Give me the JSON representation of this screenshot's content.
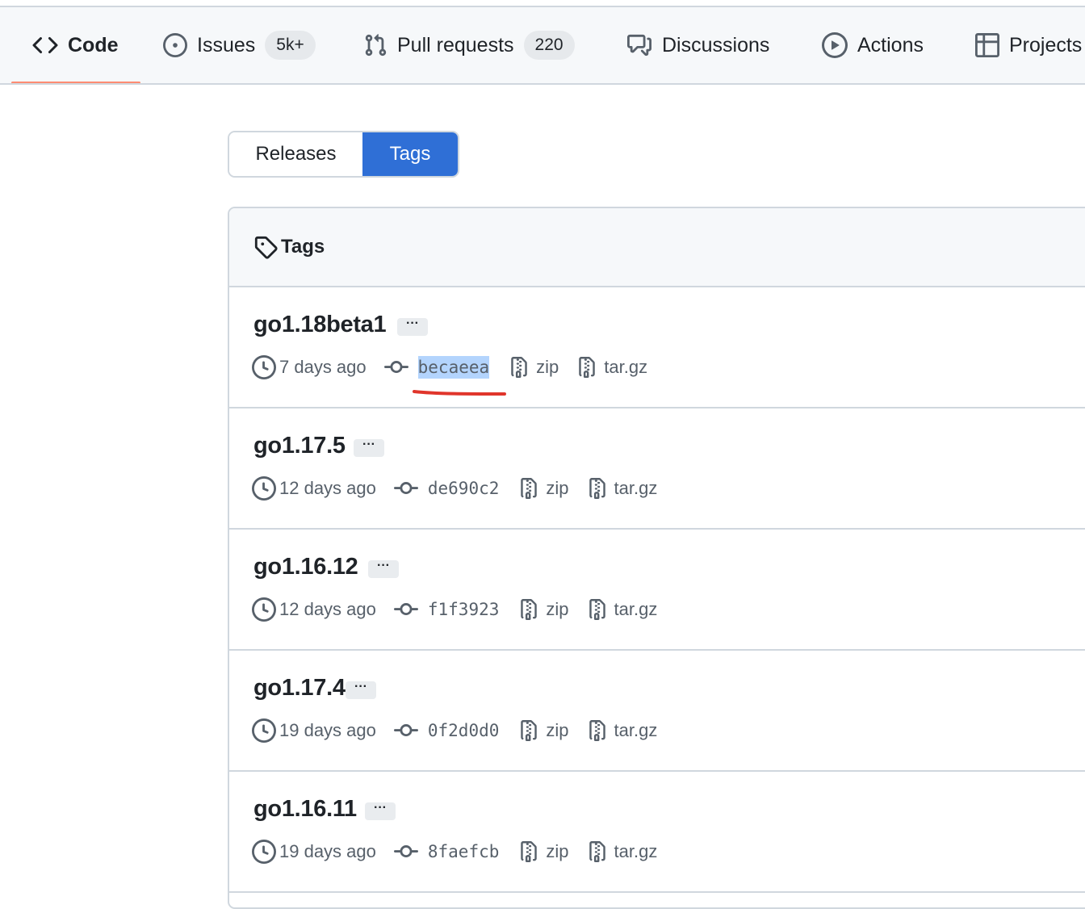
{
  "nav": {
    "items": [
      {
        "label": "Code",
        "icon": "code-icon",
        "selected": true
      },
      {
        "label": "Issues",
        "icon": "issue-opened-icon",
        "counter": "5k+"
      },
      {
        "label": "Pull requests",
        "icon": "git-pull-request-icon",
        "counter": "220"
      },
      {
        "label": "Discussions",
        "icon": "comment-discussion-icon"
      },
      {
        "label": "Actions",
        "icon": "play-icon"
      },
      {
        "label": "Projects",
        "icon": "table-icon"
      }
    ]
  },
  "toggle": {
    "releases_label": "Releases",
    "tags_label": "Tags",
    "active": "Tags"
  },
  "tags_box": {
    "header_title": "Tags",
    "more_label": "···",
    "zip_label": "zip",
    "targz_label": "tar.gz",
    "rows": [
      {
        "name": "go1.18beta1",
        "date": "7 days ago",
        "commit": "becaeea",
        "highlighted": true
      },
      {
        "name": "go1.17.5",
        "date": "12 days ago",
        "commit": "de690c2"
      },
      {
        "name": "go1.16.12",
        "date": "12 days ago",
        "commit": "f1f3923"
      },
      {
        "name": "go1.17.4",
        "date": "19 days ago",
        "commit": "0f2d0d0"
      },
      {
        "name": "go1.16.11",
        "date": "19 days ago",
        "commit": "8faefcb"
      }
    ]
  },
  "colors": {
    "accent": "#2f6fd6",
    "nav_underline": "#fd8c73",
    "annotation": "#e0352b",
    "highlight": "#b3d4fd"
  }
}
